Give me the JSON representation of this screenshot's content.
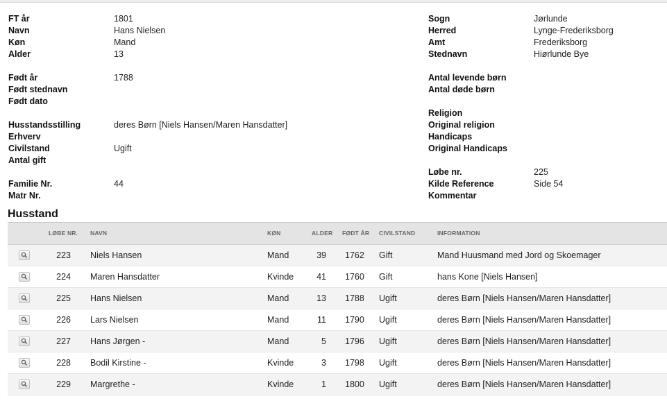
{
  "details_left": [
    {
      "label": "FT år",
      "value": "1801"
    },
    {
      "label": "Navn",
      "value": "Hans Nielsen"
    },
    {
      "label": "Køn",
      "value": "Mand"
    },
    {
      "label": "Alder",
      "value": "13"
    },
    {
      "label": "Født år",
      "value": "1788"
    },
    {
      "label": "Født stednavn",
      "value": ""
    },
    {
      "label": "Født dato",
      "value": ""
    },
    {
      "label": "Husstandsstilling",
      "value": "deres Børn [Niels Hansen/Maren Hansdatter]"
    },
    {
      "label": "Erhverv",
      "value": ""
    },
    {
      "label": "Civilstand",
      "value": "Ugift"
    },
    {
      "label": "Antal gift",
      "value": ""
    },
    {
      "label": "Familie Nr.",
      "value": "44"
    },
    {
      "label": "Matr Nr.",
      "value": ""
    }
  ],
  "details_right": [
    {
      "label": "Sogn",
      "value": "Jørlunde"
    },
    {
      "label": "Herred",
      "value": "Lynge-Frederiksborg"
    },
    {
      "label": "Amt",
      "value": "Frederiksborg"
    },
    {
      "label": "Stednavn",
      "value": "Hiørlunde Bye"
    },
    {
      "label": "Antal levende børn",
      "value": ""
    },
    {
      "label": "Antal døde børn",
      "value": ""
    },
    {
      "label": "Religion",
      "value": ""
    },
    {
      "label": "Original religion",
      "value": ""
    },
    {
      "label": "Handicaps",
      "value": ""
    },
    {
      "label": "Original Handicaps",
      "value": ""
    },
    {
      "label": "Løbe nr.",
      "value": "225"
    },
    {
      "label": "Kilde Reference",
      "value": "Side 54"
    },
    {
      "label": "Kommentar",
      "value": ""
    }
  ],
  "household": {
    "title": "Husstand",
    "columns": {
      "lobe_nr": "LØBE NR.",
      "navn": "NAVN",
      "kon": "KØN",
      "alder": "ALDER",
      "fodt_ar": "FØDT ÅR",
      "civilstand": "CIVILSTAND",
      "information": "INFORMATION"
    },
    "rows": [
      {
        "lobe_nr": "223",
        "navn": "Niels Hansen",
        "kon": "Mand",
        "alder": "39",
        "fodt_ar": "1762",
        "civilstand": "Gift",
        "information": "Mand Huusmand med Jord og Skoemager"
      },
      {
        "lobe_nr": "224",
        "navn": "Maren Hansdatter",
        "kon": "Kvinde",
        "alder": "41",
        "fodt_ar": "1760",
        "civilstand": "Gift",
        "information": "hans Kone [Niels Hansen]"
      },
      {
        "lobe_nr": "225",
        "navn": "Hans Nielsen",
        "kon": "Mand",
        "alder": "13",
        "fodt_ar": "1788",
        "civilstand": "Ugift",
        "information": "deres Børn [Niels Hansen/Maren Hansdatter]"
      },
      {
        "lobe_nr": "226",
        "navn": "Lars Nielsen",
        "kon": "Mand",
        "alder": "11",
        "fodt_ar": "1790",
        "civilstand": "Ugift",
        "information": "deres Børn [Niels Hansen/Maren Hansdatter]"
      },
      {
        "lobe_nr": "227",
        "navn": "Hans Jørgen -",
        "kon": "Mand",
        "alder": "5",
        "fodt_ar": "1796",
        "civilstand": "Ugift",
        "information": "deres Børn [Niels Hansen/Maren Hansdatter]"
      },
      {
        "lobe_nr": "228",
        "navn": "Bodil Kirstine -",
        "kon": "Kvinde",
        "alder": "3",
        "fodt_ar": "1798",
        "civilstand": "Ugift",
        "information": "deres Børn [Niels Hansen/Maren Hansdatter]"
      },
      {
        "lobe_nr": "229",
        "navn": "Margrethe -",
        "kon": "Kvinde",
        "alder": "1",
        "fodt_ar": "1800",
        "civilstand": "Ugift",
        "information": "deres Børn [Niels Hansen/Maren Hansdatter]"
      }
    ],
    "row_icon": "magnifier-icon"
  }
}
